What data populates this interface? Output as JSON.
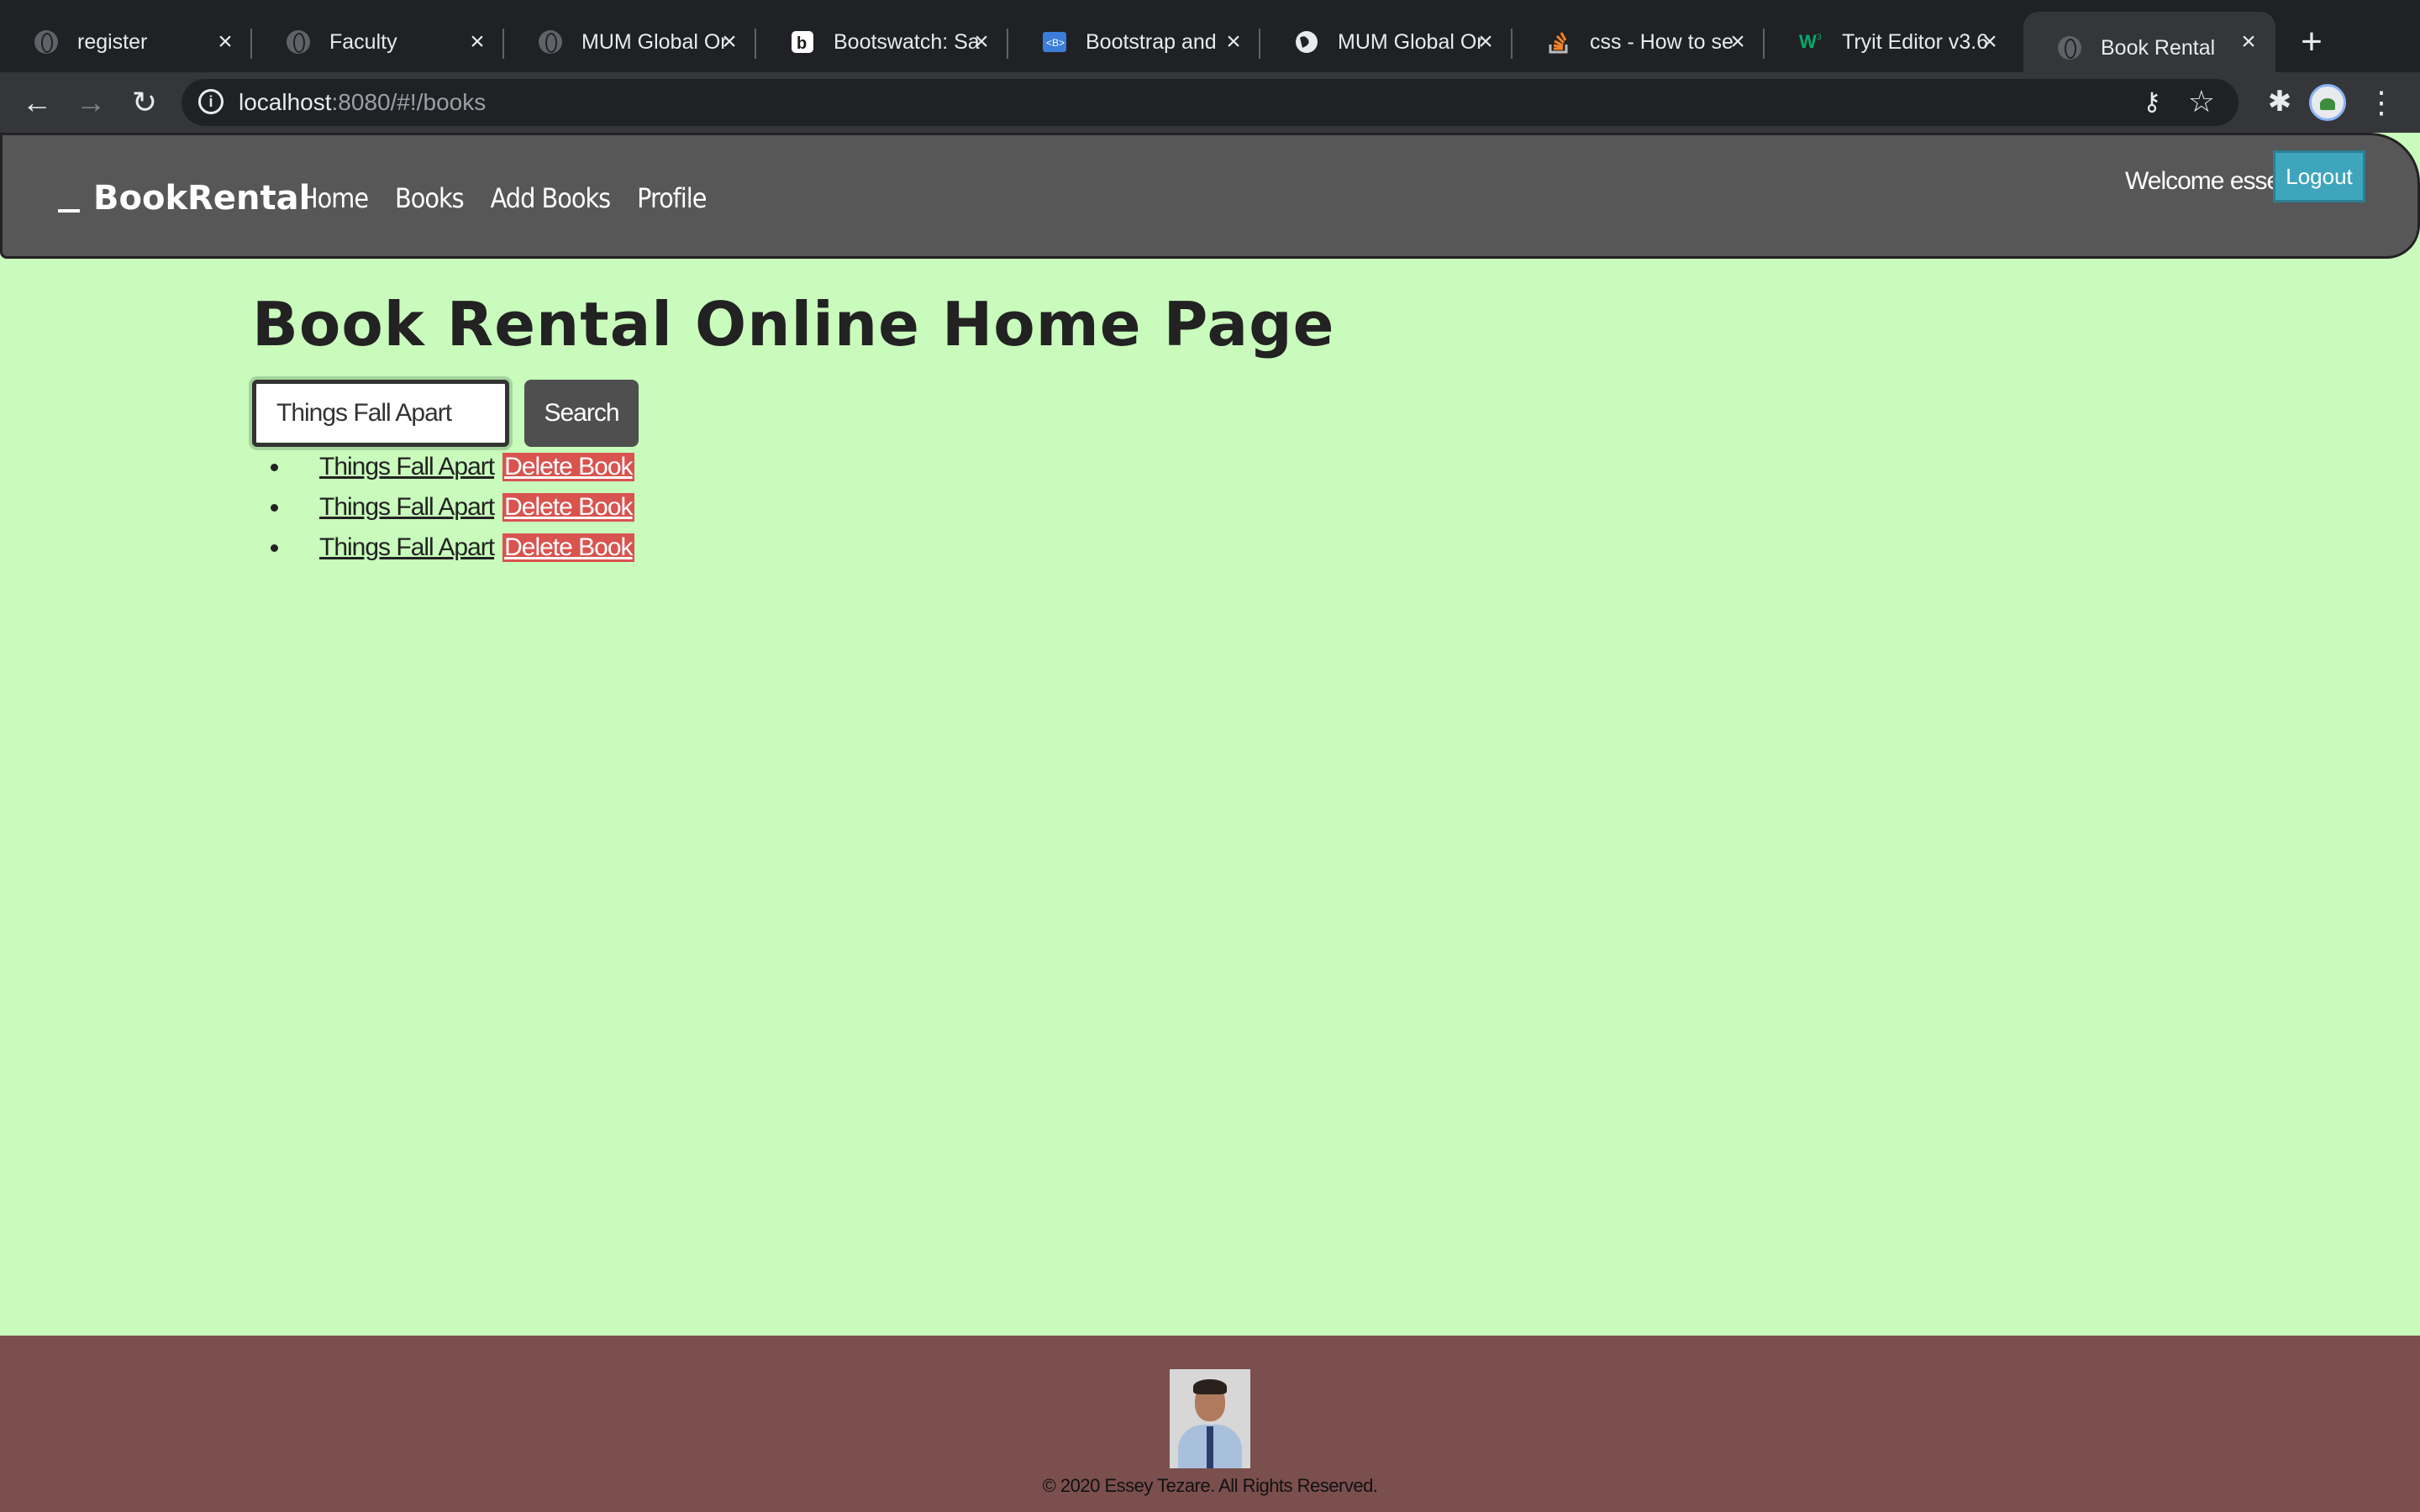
{
  "browser": {
    "tabs": [
      {
        "title": "register",
        "icon": "globe-icon"
      },
      {
        "title": "Faculty",
        "icon": "globe-icon"
      },
      {
        "title": "MUM Global Or",
        "icon": "globe-icon"
      },
      {
        "title": "Bootswatch: Sa",
        "icon": "bootswatch-icon"
      },
      {
        "title": "Bootstrap and",
        "icon": "bootstrap-icon"
      },
      {
        "title": "MUM Global Or",
        "icon": "globe-icon"
      },
      {
        "title": "css - How to se",
        "icon": "stackoverflow-icon"
      },
      {
        "title": "Tryit Editor v3.6",
        "icon": "w3schools-icon"
      },
      {
        "title": "Book Rental",
        "icon": "globe-icon",
        "active": true
      }
    ],
    "url_host": "localhost",
    "url_rest": ":8080/#!/books"
  },
  "site": {
    "brand": "BookRental",
    "nav": [
      "Home",
      "Books",
      "Add Books",
      "Profile"
    ],
    "welcome": "Welcome essey",
    "logout_label": "Logout"
  },
  "main": {
    "title": "Book Rental Online Home Page",
    "search": {
      "value": "Things Fall Apart",
      "button": "Search"
    },
    "results": [
      {
        "title": "Things Fall Apart",
        "delete_label": "Delete Book"
      },
      {
        "title": "Things Fall Apart",
        "delete_label": "Delete Book"
      },
      {
        "title": "Things Fall Apart",
        "delete_label": "Delete Book"
      }
    ]
  },
  "footer": {
    "copyright": "© 2020 Essey Tezare. All Rights Reserved."
  },
  "colors": {
    "page_bg": "#c9fcbc",
    "navbar_bg": "#575757",
    "footer_bg": "#7a4f4d",
    "logout_bg": "#3fa5bd",
    "delete_bg": "#d9534f"
  }
}
